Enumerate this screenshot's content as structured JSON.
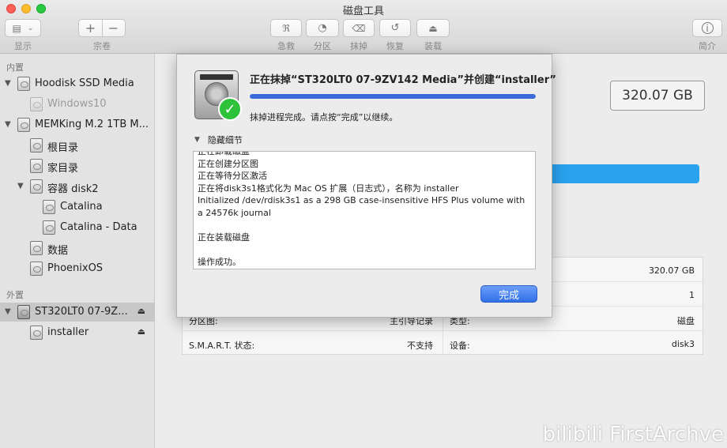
{
  "window": {
    "title": "磁盘工具"
  },
  "toolbar": {
    "view_label": "显示",
    "volume_label": "宗卷",
    "add_symbol": "+",
    "remove_symbol": "−",
    "firstaid_label": "急救",
    "partition_label": "分区",
    "erase_label": "抹掉",
    "restore_label": "恢复",
    "mount_label": "装载",
    "info_label": "简介"
  },
  "sidebar": {
    "internal_header": "内置",
    "external_header": "外置",
    "items": [
      {
        "label": "Hoodisk SSD Media"
      },
      {
        "label": "Windows10"
      },
      {
        "label": "MEMKing M.2 1TB M..."
      },
      {
        "label": "根目录"
      },
      {
        "label": "家目录"
      },
      {
        "label": "容器 disk2"
      },
      {
        "label": "Catalina"
      },
      {
        "label": "Catalina - Data"
      },
      {
        "label": "数据"
      },
      {
        "label": "PhoenixOS"
      },
      {
        "label": "ST320LT0 07-9Z..."
      },
      {
        "label": "installer"
      }
    ]
  },
  "main": {
    "capacity": "320.07 GB",
    "info": {
      "capacity_value": "320.07 GB",
      "child_count_value": "1",
      "partition_map_label": "分区图:",
      "partition_map_value": "主引导记录",
      "type_label": "类型:",
      "type_value": "磁盘",
      "smart_label": "S.M.A.R.T. 状态:",
      "smart_value": "不支持",
      "device_label": "设备:",
      "device_value": "disk3"
    }
  },
  "sheet": {
    "title": "正在抹掉“ST320LT0 07-9ZV142 Media”并创建“installer”",
    "progress_fraction": 1.0,
    "status": "抹掉进程完成。请点按“完成”以继续。",
    "details_toggle": "隐藏细节",
    "log": [
      "正在卸载磁盘",
      "正在创建分区图",
      "正在等待分区激活",
      "正在将disk3s1格式化为 Mac OS 扩展（日志式），名称为 installer",
      "Initialized /dev/rdisk3s1 as a 298 GB case-insensitive HFS Plus volume with a 24576k journal",
      "",
      "正在装载磁盘",
      "",
      "操作成功。"
    ],
    "done_label": "完成"
  },
  "watermark": "bilibili FirstArchve",
  "colors": {
    "accent": "#3a6cdc",
    "usage_bar": "#29a3ee",
    "success": "#2ec13a"
  },
  "icons": [
    "sidebar-view-icon",
    "stethoscope-icon",
    "partition-pie-icon",
    "erase-icon",
    "restore-icon",
    "mount-icon",
    "info-icon",
    "disk-icon",
    "eject-icon",
    "checkmark-icon"
  ]
}
